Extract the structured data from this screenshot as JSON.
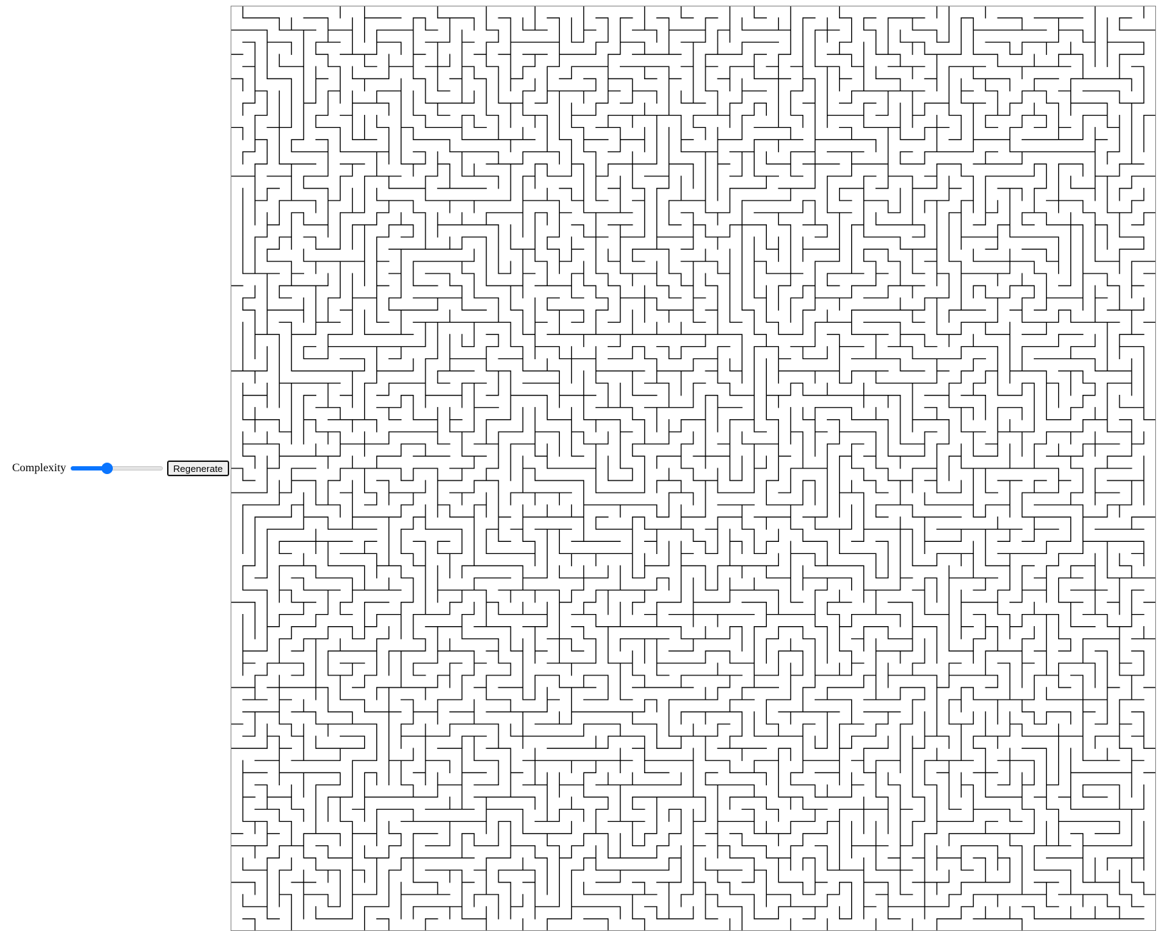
{
  "controls": {
    "complexity_label": "Complexity",
    "complexity_value": 0.38,
    "regenerate_label": "Regenerate"
  },
  "maze": {
    "rows": 76,
    "cols": 76,
    "wall_color": "#000000",
    "border_color": "#888888",
    "slider_accent": "#0a75ff"
  }
}
